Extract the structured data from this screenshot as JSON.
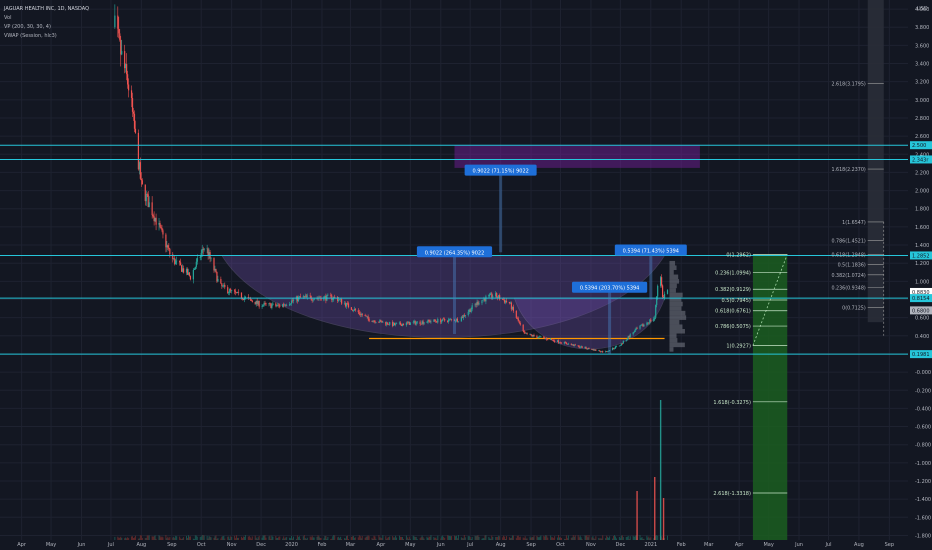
{
  "legend": {
    "title": "JAGUAR HEALTH INC, 1D, NASDAQ",
    "line2": "Vol",
    "line3": "VP (200, 30, 30, 4)",
    "line4": "VWAP (Session, hlc3)"
  },
  "toolbar": {
    "close_icon": "close-icon",
    "expand_icon": "expand-icon"
  },
  "colors": {
    "background": "#131722",
    "grid": "#1e2230",
    "axis_text": "#b2b5be",
    "hline": "#26c6da",
    "fib_green": "#4caf50",
    "purple_box": "#7b1fa2",
    "up_candle": "#26a69a",
    "down_candle": "#ef5350",
    "label_blue": "#1e6fd9"
  },
  "axes": {
    "y_ticks": [
      "4.000",
      "3.800",
      "3.600",
      "3.400",
      "3.200",
      "3.000",
      "2.800",
      "2.600",
      "2.400",
      "2.200",
      "2.000",
      "1.800",
      "1.600",
      "1.400",
      "1.200",
      "1.000",
      "0.800",
      "0.600",
      "0.400",
      "0.200",
      "-0.000",
      "-0.200",
      "-0.400",
      "-0.600",
      "-0.800",
      "-1.000",
      "-1.200",
      "-1.400",
      "-1.600",
      "-1.800"
    ],
    "y_top_label": "USD",
    "x_ticks": [
      "Apr",
      "May",
      "Jun",
      "Jul",
      "Aug",
      "Sep",
      "Oct",
      "Nov",
      "Dec",
      "2020",
      "Feb",
      "Mar",
      "Apr",
      "May",
      "Jun",
      "Jul",
      "Aug",
      "Sep",
      "Oct",
      "Nov",
      "Dec",
      "2021",
      "Feb",
      "Mar",
      "Apr",
      "May",
      "Jun",
      "Jul",
      "Aug",
      "Sep"
    ],
    "price_badges": [
      {
        "value": "2.500",
        "color": "#26c6da",
        "text_color": "#131722"
      },
      {
        "value": "2.343r",
        "color": "#26c6da",
        "text_color": "#131722"
      },
      {
        "value": "1.2852",
        "color": "#26c6da",
        "text_color": "#131722"
      },
      {
        "value": "0.8830",
        "color": "#ffffff",
        "text_color": "#131722"
      },
      {
        "value": "0.8154",
        "color": "#26c6da",
        "text_color": "#131722"
      },
      {
        "value": "0.6800",
        "color": "#b2b5be",
        "text_color": "#131722"
      },
      {
        "value": "0.1981",
        "color": "#26c6da",
        "text_color": "#131722"
      }
    ]
  },
  "chart_data": {
    "type": "candlestick",
    "title": "JAGUAR HEALTH INC, 1D, NASDAQ",
    "ylim": [
      -1.85,
      4.1
    ],
    "y_unit": "USD",
    "horizontal_levels": [
      2.5,
      2.343,
      1.2852,
      0.8154,
      0.1981
    ],
    "price_path": [
      {
        "date": "2019-07-05",
        "price": 3.8
      },
      {
        "date": "2019-07-20",
        "price": 3.1
      },
      {
        "date": "2019-08-01",
        "price": 2.05
      },
      {
        "date": "2019-08-15",
        "price": 1.7
      },
      {
        "date": "2019-09-01",
        "price": 1.25
      },
      {
        "date": "2019-09-20",
        "price": 1.05
      },
      {
        "date": "2019-10-05",
        "price": 1.4
      },
      {
        "date": "2019-10-20",
        "price": 0.95
      },
      {
        "date": "2019-11-01",
        "price": 0.88
      },
      {
        "date": "2019-12-01",
        "price": 0.74
      },
      {
        "date": "2019-12-20",
        "price": 0.73
      },
      {
        "date": "2020-01-10",
        "price": 0.82
      },
      {
        "date": "2020-02-15",
        "price": 0.82
      },
      {
        "date": "2020-03-20",
        "price": 0.58
      },
      {
        "date": "2020-04-15",
        "price": 0.52
      },
      {
        "date": "2020-05-20",
        "price": 0.56
      },
      {
        "date": "2020-06-20",
        "price": 0.58
      },
      {
        "date": "2020-07-10",
        "price": 0.78
      },
      {
        "date": "2020-07-25",
        "price": 0.85
      },
      {
        "date": "2020-08-10",
        "price": 0.76
      },
      {
        "date": "2020-08-25",
        "price": 0.42
      },
      {
        "date": "2020-09-20",
        "price": 0.36
      },
      {
        "date": "2020-10-20",
        "price": 0.28
      },
      {
        "date": "2020-11-15",
        "price": 0.22
      },
      {
        "date": "2020-12-01",
        "price": 0.3
      },
      {
        "date": "2020-12-15",
        "price": 0.45
      },
      {
        "date": "2021-01-05",
        "price": 0.6
      },
      {
        "date": "2021-01-10",
        "price": 1.2
      },
      {
        "date": "2021-01-13",
        "price": 0.82
      },
      {
        "date": "2021-01-18",
        "price": 0.9
      }
    ],
    "volume_spikes": [
      {
        "date": "2020-12-18",
        "value": 0.35
      },
      {
        "date": "2021-01-05",
        "value": 0.45
      },
      {
        "date": "2021-01-11",
        "value": 1.0
      },
      {
        "date": "2021-01-14",
        "value": 0.3
      }
    ],
    "purple_box": {
      "date_from": "2020-06-15",
      "date_to": "2021-02-20",
      "price_from": 2.25,
      "price_to": 2.5
    },
    "arc_annotations": [
      {
        "from": "2019-10-22",
        "to": "2021-01-15",
        "rim": 1.2852,
        "bottom": 0.3
      },
      {
        "from": "2020-08-15",
        "to": "2021-01-15",
        "rim": 0.8154,
        "bottom": 0.2
      }
    ],
    "measure_labels": [
      {
        "text": "0.9022 (71.15%) 9022",
        "date": "2020-08-01",
        "price": 2.22
      },
      {
        "text": "0.9022 (264.35%) 9022",
        "date": "2020-06-15",
        "price": 1.32
      },
      {
        "text": "0.5394 (71.43%) 5394",
        "date": "2021-01-01",
        "price": 1.34
      },
      {
        "text": "0.5394 (203.70%) 5394",
        "date": "2020-11-20",
        "price": 0.93
      }
    ],
    "fib_levels_left": [
      {
        "label": "0(1.2962)",
        "price": 1.2962
      },
      {
        "label": "0.236(1.0994)",
        "price": 1.0994
      },
      {
        "label": "0.382(0.9129)",
        "price": 0.9129
      },
      {
        "label": "0.5(0.7945)",
        "price": 0.7945
      },
      {
        "label": "0.618(0.6761)",
        "price": 0.6761
      },
      {
        "label": "0.786(0.5075)",
        "price": 0.5075
      },
      {
        "label": "1(0.2927)",
        "price": 0.2927
      },
      {
        "label": "1.618(-0.3275)",
        "price": -0.3275
      },
      {
        "label": "2.618(-1.3318)",
        "price": -1.3318
      }
    ],
    "fib_levels_right": [
      {
        "label": "2.618(3.1795)",
        "price": 3.1795
      },
      {
        "label": "1.618(2.2370)",
        "price": 2.237
      },
      {
        "label": "1(1.6547)",
        "price": 1.6547
      },
      {
        "label": "0.786(1.4521)",
        "price": 1.4521
      },
      {
        "label": "0.618(1.2948)",
        "price": 1.2948
      },
      {
        "label": "0.5(1.1836)",
        "price": 1.1836
      },
      {
        "label": "0.382(1.0724)",
        "price": 1.0724
      },
      {
        "label": "0.236(0.9348)",
        "price": 0.9348
      },
      {
        "label": "0(0.7125)",
        "price": 0.7125
      }
    ]
  }
}
